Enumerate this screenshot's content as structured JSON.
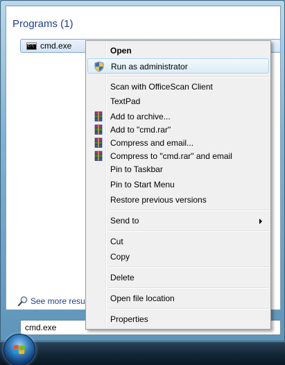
{
  "start_menu": {
    "programs_header": "Programs (1)",
    "result_item": {
      "label": "cmd.exe",
      "icon": "cmd-icon"
    },
    "see_more": {
      "label": "See more results",
      "icon": "magnifier-icon"
    },
    "search_box": {
      "value": "cmd.exe"
    }
  },
  "context_menu": {
    "items": [
      {
        "label": "Open"
      },
      {
        "label": "Run as administrator",
        "icon": "uac-shield-icon"
      },
      {
        "label": "Scan with OfficeScan Client"
      },
      {
        "label": "TextPad"
      },
      {
        "label": "Add to archive...",
        "icon": "winrar-icon"
      },
      {
        "label": "Add to \"cmd.rar\"",
        "icon": "winrar-icon"
      },
      {
        "label": "Compress and email...",
        "icon": "winrar-icon"
      },
      {
        "label": "Compress to \"cmd.rar\" and email",
        "icon": "winrar-icon"
      },
      {
        "label": "Pin to Taskbar"
      },
      {
        "label": "Pin to Start Menu"
      },
      {
        "label": "Restore previous versions"
      },
      {
        "label": "Send to"
      },
      {
        "label": "Cut"
      },
      {
        "label": "Copy"
      },
      {
        "label": "Delete"
      },
      {
        "label": "Open file location"
      },
      {
        "label": "Properties"
      }
    ]
  },
  "taskbar": {
    "start_button_icon": "windows-orb-icon"
  },
  "colors": {
    "header_text": "#1e3f8f",
    "menu_background": "#f0f0f0",
    "highlight_border": "#a8d8eb"
  }
}
